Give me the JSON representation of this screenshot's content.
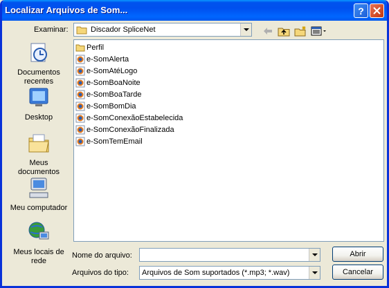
{
  "window": {
    "title": "Localizar Arquivos de Som...",
    "help_label": "?"
  },
  "lookin": {
    "label": "Examinar:",
    "value": "Discador SpliceNet"
  },
  "places": [
    {
      "label": "Documentos recentes",
      "icon": "recent-documents-icon"
    },
    {
      "label": "Desktop",
      "icon": "desktop-icon"
    },
    {
      "label": "Meus documentos",
      "icon": "my-documents-icon"
    },
    {
      "label": "Meu computador",
      "icon": "my-computer-icon"
    },
    {
      "label": "Meus locais de rede",
      "icon": "network-places-icon"
    }
  ],
  "files": [
    {
      "name": "Perfil",
      "type": "folder"
    },
    {
      "name": "e-SomAlerta",
      "type": "sound"
    },
    {
      "name": "e-SomAtéLogo",
      "type": "sound"
    },
    {
      "name": "e-SomBoaNoite",
      "type": "sound"
    },
    {
      "name": "e-SomBoaTarde",
      "type": "sound"
    },
    {
      "name": "e-SomBomDia",
      "type": "sound"
    },
    {
      "name": "e-SomConexãoEstabelecida",
      "type": "sound"
    },
    {
      "name": "e-SomConexãoFinalizada",
      "type": "sound"
    },
    {
      "name": "e-SomTemEmail",
      "type": "sound"
    }
  ],
  "filename": {
    "label": "Nome do arquivo:",
    "value": ""
  },
  "filetype": {
    "label": "Arquivos do tipo:",
    "value": "Arquivos de Som suportados (*.mp3; *.wav)"
  },
  "buttons": {
    "open": "Abrir",
    "cancel": "Cancelar"
  },
  "colors": {
    "titlebar": "#0054e3",
    "face": "#ece9d8",
    "border": "#7f9db9"
  }
}
